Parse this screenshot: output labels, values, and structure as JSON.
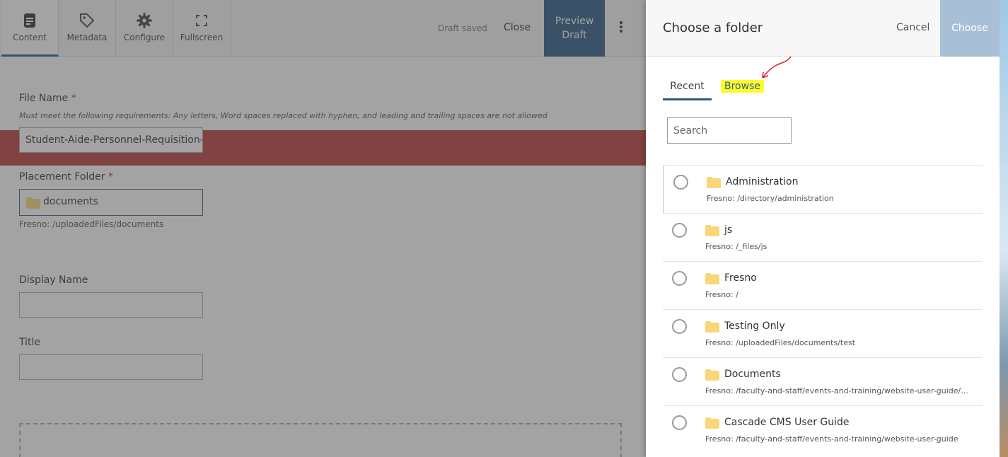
{
  "toolbar": {
    "items": [
      {
        "label": "Content",
        "icon": "document-icon"
      },
      {
        "label": "Metadata",
        "icon": "tag-icon"
      },
      {
        "label": "Configure",
        "icon": "gear-icon"
      },
      {
        "label": "Fullscreen",
        "icon": "fullscreen-icon"
      }
    ],
    "status": "Draft saved",
    "close_label": "Close",
    "preview_line1": "Preview",
    "preview_line2": "Draft"
  },
  "form": {
    "file_name_label": "File Name",
    "required_mark": "*",
    "file_name_hint": "Must meet the following requirements: Any letters, Word spaces replaced with hyphen, and leading and trailing spaces are not allowed",
    "file_name_value": "Student-Aide-Personnel-Requisition-F",
    "placement_label": "Placement Folder",
    "placement_value": "documents",
    "placement_path": "Fresno: /uploadedFiles/documents",
    "display_name_label": "Display Name",
    "title_label": "Title"
  },
  "panel": {
    "title": "Choose a folder",
    "cancel_label": "Cancel",
    "choose_label": "Choose",
    "tabs": {
      "recent": "Recent",
      "browse": "Browse"
    },
    "search_placeholder": "Search",
    "folders": [
      {
        "name": "Administration",
        "path": "Fresno: /directory/administration"
      },
      {
        "name": "js",
        "path": "Fresno: /_files/js"
      },
      {
        "name": "Fresno",
        "path": "Fresno: /"
      },
      {
        "name": "Testing Only",
        "path": "Fresno: /uploadedFiles/documents/test"
      },
      {
        "name": "Documents",
        "path": "Fresno: /faculty-and-staff/events-and-training/website-user-guide/..."
      },
      {
        "name": "Cascade CMS User Guide",
        "path": "Fresno: /faculty-and-staff/events-and-training/website-user-guide"
      }
    ]
  },
  "colors": {
    "accent": "#2c5b89",
    "choose_disabled": "#a9bfd6",
    "highlight": "#fdfd2c",
    "folder": "#f8d778",
    "annotation": "#e02020"
  }
}
